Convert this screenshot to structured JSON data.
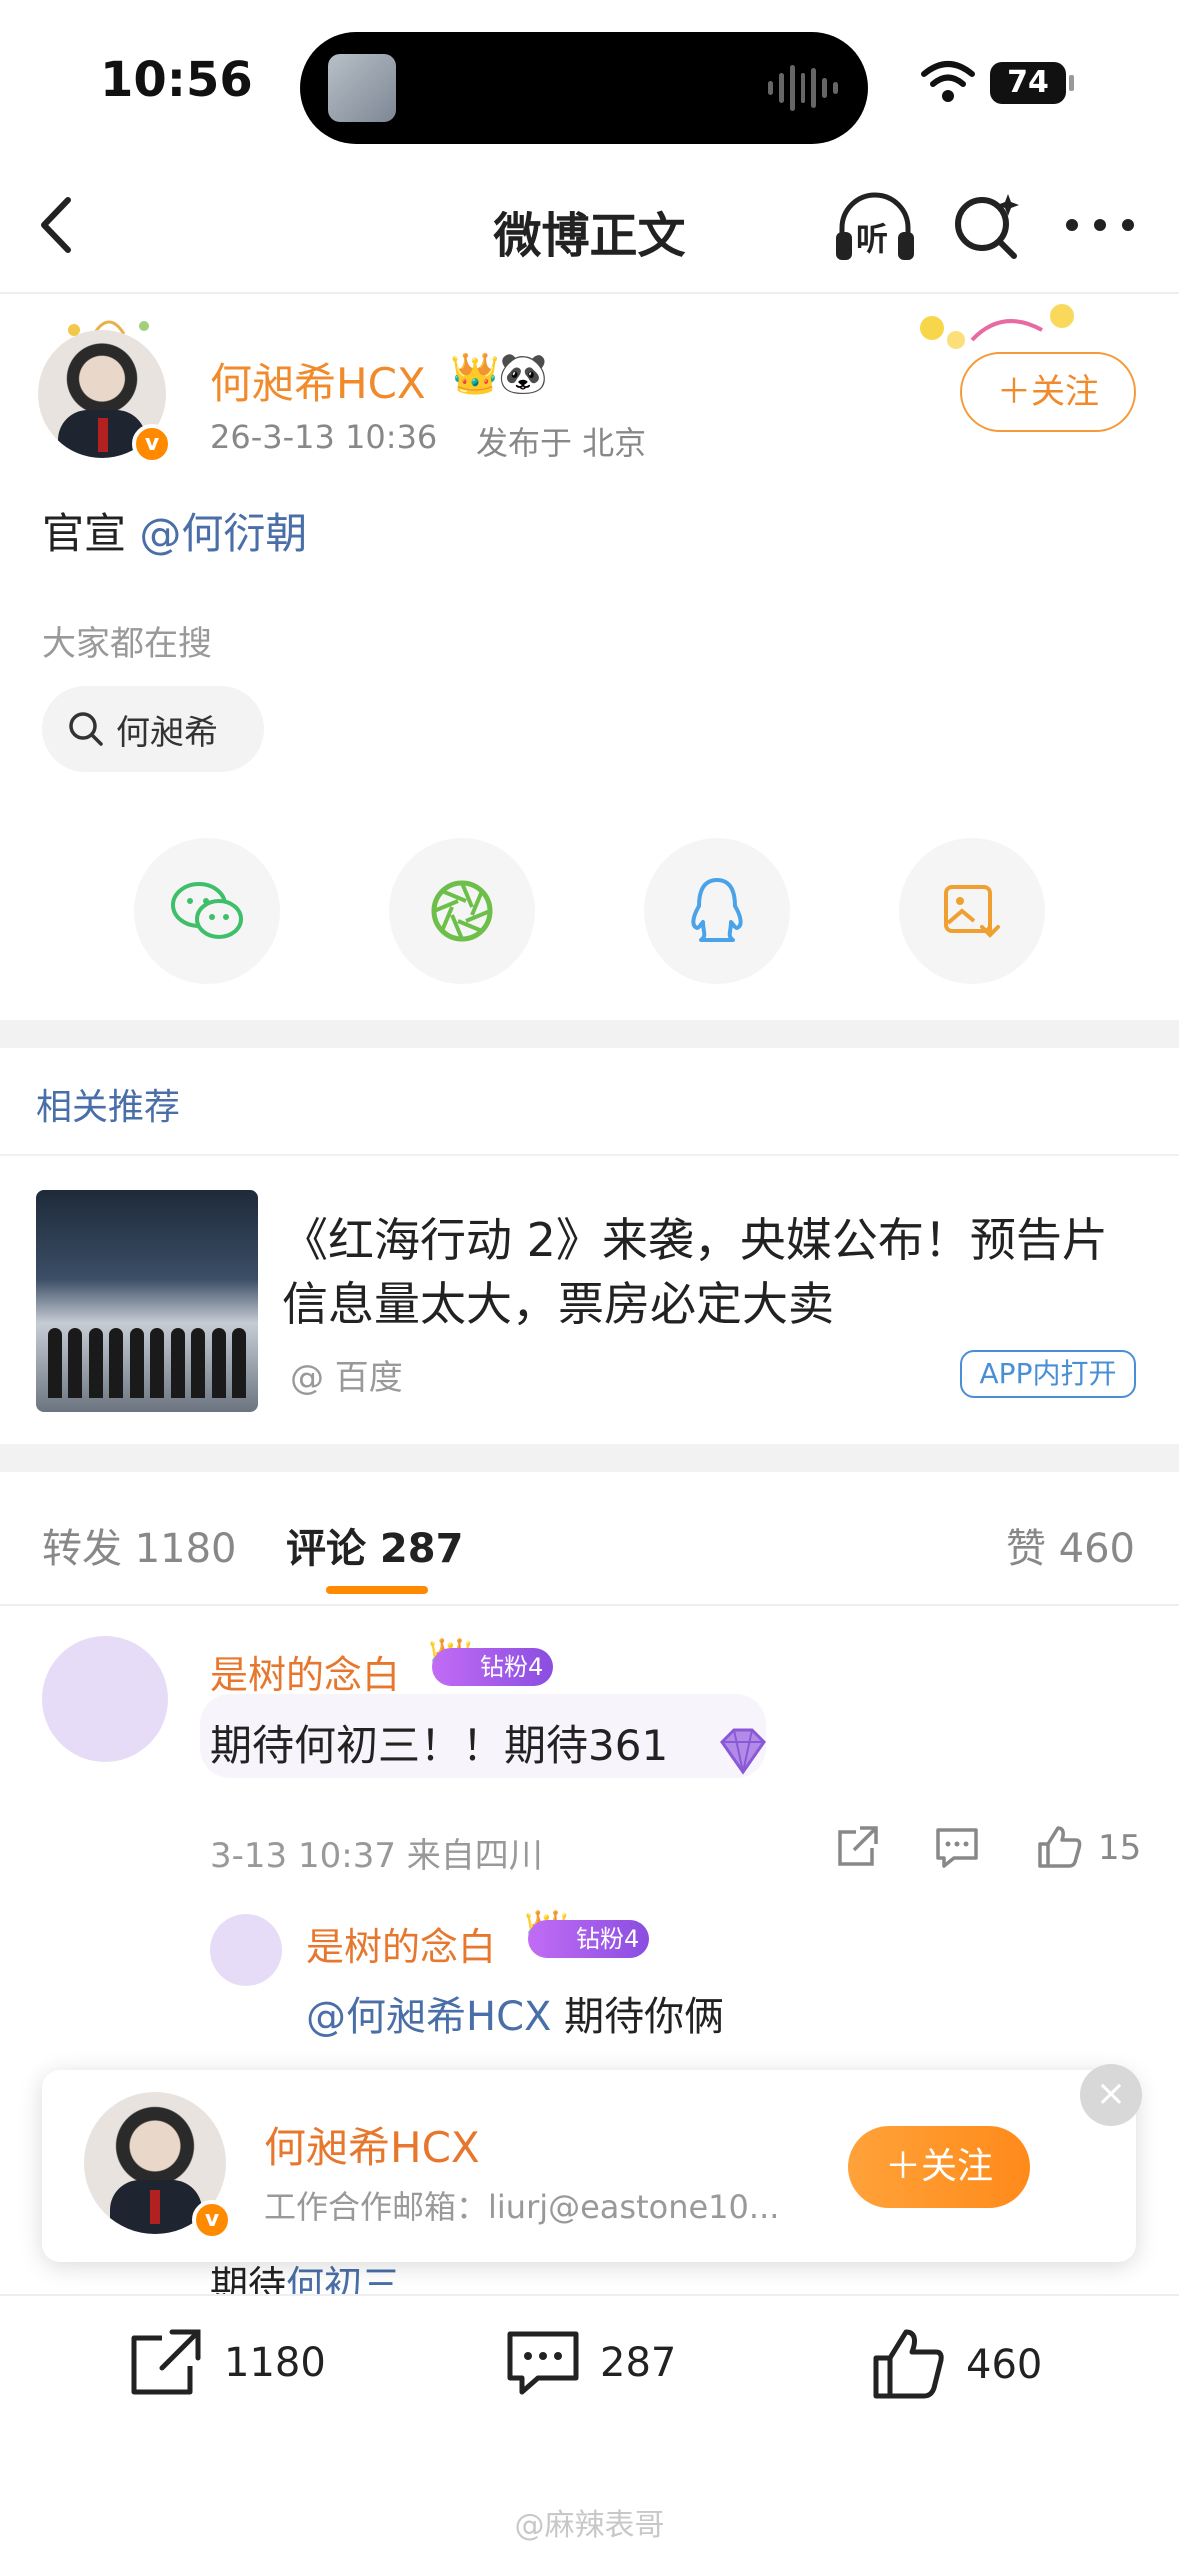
{
  "status_bar": {
    "time": "10:56",
    "battery": "74"
  },
  "nav": {
    "title": "微博正文",
    "listen_icon_label": "听"
  },
  "post": {
    "author": "何昶希HCX",
    "timestamp": "26-3-13 10:36",
    "location": "发布于 北京",
    "follow_label": "＋关注",
    "body_prefix": "官宣",
    "body_mention": "@何衍朝",
    "search_label": "大家都在搜",
    "search_chip": "何昶希"
  },
  "related": {
    "section_title": "相关推荐",
    "title": "《红海行动 2》来袭，央媒公布！预告片信息量太大，票房必定大卖",
    "source": "@ 百度",
    "app_button": "APP内打开"
  },
  "tabs": {
    "repost": "转发 1180",
    "comment": "评论 287",
    "like": "赞 460"
  },
  "comment": {
    "author": "是树的念白",
    "badge": "钻粉4",
    "text": "期待何初三！！期待361",
    "meta": "3-13 10:37 来自四川",
    "likes": "15"
  },
  "reply": {
    "author": "是树的念白",
    "badge": "钻粉4",
    "mention": "@何昶希HCX",
    "text": " 期待你俩"
  },
  "float_card": {
    "name": "何昶希HCX",
    "email": "工作合作邮箱：liurj@eastone10...",
    "follow_label": "＋关注",
    "close": "×"
  },
  "peek": {
    "prefix": "期待",
    "mention": "何初三"
  },
  "bottom_bar": {
    "repost": "1180",
    "comment": "287",
    "like": "460"
  },
  "watermark": "@麻辣表哥",
  "colors": {
    "accent": "#ff8a00",
    "link": "#4a6ea8",
    "name": "#e8772e"
  }
}
